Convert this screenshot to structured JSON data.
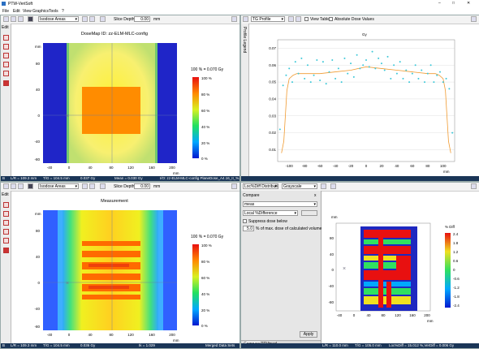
{
  "app": {
    "title": "PTW-VeriSoft"
  },
  "menu": [
    "File",
    "Edit",
    "View",
    "Graphics",
    "Tools",
    "?"
  ],
  "top_left": {
    "dose_select": "Isodose Areas",
    "slice_depth_label": "Slice Depth",
    "slice_depth_value": "0.00",
    "slice_depth_unit": "mm",
    "title": "DoseMap ID: zz-ELM-MLC-config",
    "scale_header": "100 % = 0.070 Gy",
    "x_axis_label": "mm",
    "y_axis_label": "mm",
    "x_ticks": [
      "-40",
      "0",
      "40",
      "80",
      "120",
      "160",
      "200"
    ],
    "y_ticks": [
      "80",
      "40",
      "0",
      "-40",
      "-80"
    ],
    "status": [
      "B",
      "L/R = 109.3 mm",
      "T/G = 104.5 mm",
      "0.037 Gy",
      "Mean = 0.030 Gy",
      "I/O: zz-ELM-MLC-config PlaneDose_A4.16_II_%..."
    ]
  },
  "bottom_left": {
    "dose_select": "Isodose Areas",
    "slice_depth_label": "Slice Depth",
    "slice_depth_value": "0.00",
    "slice_depth_unit": "mm",
    "title": "Measurement",
    "scale_header": "100 % = 0.070 Gy",
    "x_axis_label": "mm",
    "y_axis_label": "mm",
    "x_ticks": [
      "-40",
      "0",
      "40",
      "80",
      "120",
      "160",
      "200"
    ],
    "y_ticks": [
      "80",
      "40",
      "0",
      "-40",
      "-80"
    ],
    "status": [
      "B",
      "L/R = 109.3 mm",
      "T/G = 104.5 mm",
      "0.036 Gy",
      "Ik = 1.029",
      "Merged Data Sets"
    ]
  },
  "colorscale_labels": [
    "100 %",
    "80 %",
    "60 %",
    "40 %",
    "20 %",
    "0 %"
  ],
  "top_right": {
    "profile_select": "TG Profile",
    "view_table": "View Table",
    "abs_dose": "Absolute Dose Values",
    "side_tab": "Profile Legend",
    "y_unit": "Gy",
    "x_unit": "mm",
    "y_ticks": [
      "0.07",
      "0.06",
      "0.05",
      "0.04",
      "0.03",
      "0.02",
      "0.01"
    ],
    "x_ticks": [
      "-100",
      "-80",
      "-60",
      "-40",
      "-20",
      "0",
      "20",
      "40",
      "60",
      "80",
      "100"
    ]
  },
  "bottom_right": {
    "analysis_select": "Loc%Diff Distribution",
    "color_select": "Grayscale",
    "compare_header": "Compare",
    "compare_value": "meas",
    "method_value": "Local %Difference",
    "suppress_label": "Suppress dose below",
    "suppress_value": "5.0",
    "suppress_text": "% of max. dose of calculated volume",
    "apply_label": "Apply",
    "tabs": [
      "Compare",
      "RTVisual"
    ],
    "legend_title": "% Diff",
    "legend_labels": [
      "2.4",
      "1.8",
      "1.2",
      "0.6",
      "0",
      "-0.6",
      "-1.2",
      "-1.8",
      "-2.4"
    ],
    "x_axis_label": "mm",
    "y_axis_label": "mm",
    "x_ticks": [
      "-40",
      "0",
      "40",
      "80",
      "120",
      "160",
      "200"
    ],
    "y_ticks": [
      "80",
      "40",
      "0",
      "-40",
      "-80"
    ],
    "status": [
      "L/R = 110.0 mm",
      "T/G = 105.0 mm",
      "Loc%Diff = 15.012 %,VerDiff = 0.006 Gy"
    ]
  },
  "colors": {
    "status_bg": "#1a3557",
    "plot_bg": "#1f25c8",
    "point": "#3cc8d8",
    "line": "#f09a30"
  }
}
